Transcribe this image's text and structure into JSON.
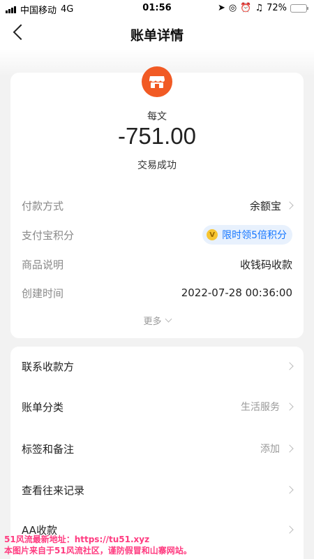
{
  "status_bar": {
    "carrier": "中国移动",
    "network": "4G",
    "time": "01:56",
    "battery_percent": "72%",
    "battery_level": 0.72
  },
  "nav": {
    "title": "账单详情",
    "back_icon": "chevron-left-icon"
  },
  "transaction": {
    "merchant_icon": "shop-icon",
    "merchant_name": "每文",
    "amount": "-751.00",
    "status": "交易成功"
  },
  "details": [
    {
      "label": "付款方式",
      "value": "余额宝",
      "has_chevron": true
    },
    {
      "label": "支付宝积分",
      "value": "限时领5倍积分",
      "pill": true,
      "coin_icon_text": "V"
    },
    {
      "label": "商品说明",
      "value": "收钱码收款"
    },
    {
      "label": "创建时间",
      "value": "2022-07-28 00:36:00"
    }
  ],
  "more_label": "更多",
  "actions": [
    {
      "label": "联系收款方",
      "value": ""
    },
    {
      "label": "账单分类",
      "value": "生活服务"
    },
    {
      "label": "标签和备注",
      "value": "添加"
    },
    {
      "label": "查看往来记录",
      "value": ""
    },
    {
      "label": "AA收款",
      "value": ""
    }
  ],
  "watermark": {
    "line1": "51风流最新地址：https://tu51.xyz",
    "line2": "本图片来自于51风流社区，谨防假冒和山寨网站。"
  },
  "colors": {
    "accent": "#1677ff",
    "merchant_icon_bg": "#f15a24",
    "watermark": "#ff3b80"
  }
}
